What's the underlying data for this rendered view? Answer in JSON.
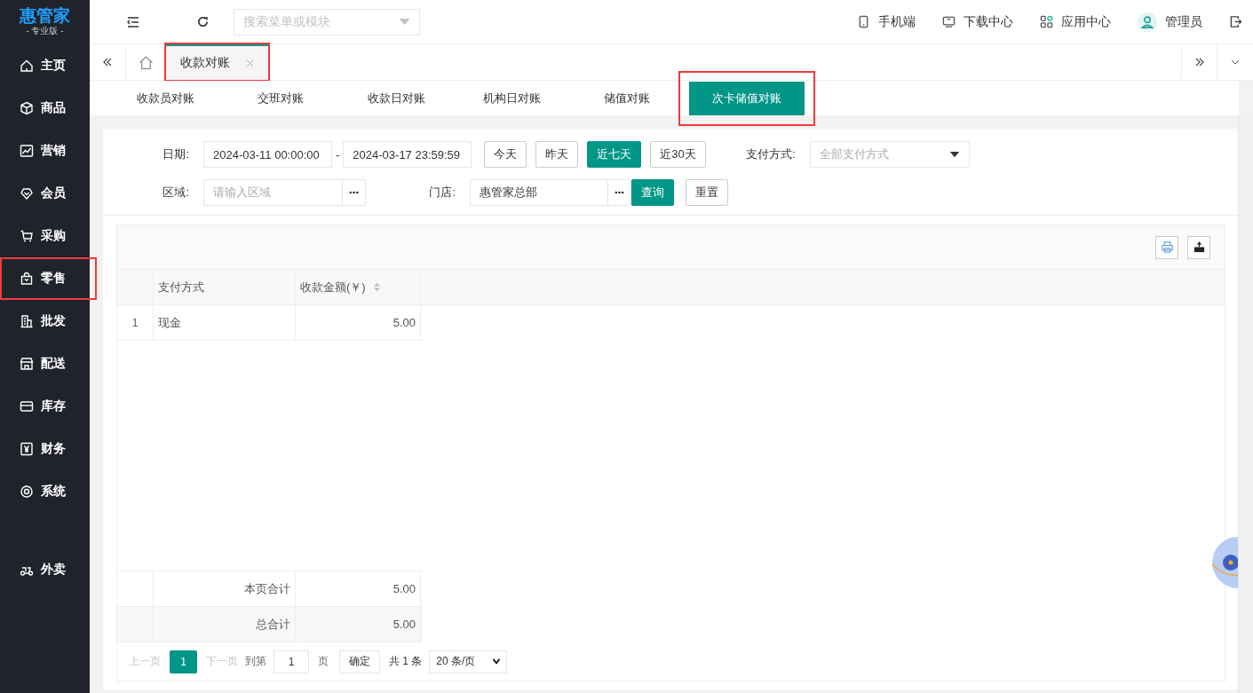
{
  "app": {
    "logo": "惠管家",
    "edition": "- 专业版 -"
  },
  "sidebar": {
    "items": [
      {
        "label": "主页",
        "highlighted": false
      },
      {
        "label": "商品",
        "highlighted": false
      },
      {
        "label": "营销",
        "highlighted": false
      },
      {
        "label": "会员",
        "highlighted": false
      },
      {
        "label": "采购",
        "highlighted": false
      },
      {
        "label": "零售",
        "highlighted": true
      },
      {
        "label": "批发",
        "highlighted": false
      },
      {
        "label": "配送",
        "highlighted": false
      },
      {
        "label": "库存",
        "highlighted": false
      },
      {
        "label": "财务",
        "highlighted": false
      },
      {
        "label": "系统",
        "highlighted": false
      }
    ],
    "bottom_items": [
      {
        "label": "外卖",
        "highlighted": false
      }
    ]
  },
  "topbar": {
    "search": {
      "placeholder": "搜索菜单或模块"
    },
    "actions": [
      {
        "label": "手机端"
      },
      {
        "label": "下载中心"
      },
      {
        "label": "应用中心"
      },
      {
        "label": "管理员"
      }
    ]
  },
  "tabs": [
    {
      "label": "收款对账",
      "selected": true,
      "highlighted": true
    }
  ],
  "subtabs": [
    {
      "label": "收款员对账",
      "selected": false,
      "highlighted": false
    },
    {
      "label": "交班对账",
      "selected": false,
      "highlighted": false
    },
    {
      "label": "收款日对账",
      "selected": false,
      "highlighted": false
    },
    {
      "label": "机构日对账",
      "selected": false,
      "highlighted": false
    },
    {
      "label": "储值对账",
      "selected": false,
      "highlighted": false
    },
    {
      "label": "次卡储值对账",
      "selected": true,
      "highlighted": true
    }
  ],
  "filters": {
    "date_label": "日期:",
    "date_start": "2024-03-11 00:00:00",
    "date_separator": "-",
    "date_end": "2024-03-17 23:59:59",
    "quick_ranges": [
      {
        "label": "今天",
        "selected": false
      },
      {
        "label": "昨天",
        "selected": false
      },
      {
        "label": "近七天",
        "selected": true
      },
      {
        "label": "近30天",
        "selected": false
      }
    ],
    "payment_label": "支付方式:",
    "payment_placeholder": "全部支付方式",
    "region_label": "区域:",
    "region_placeholder": "请输入区域",
    "store_label": "门店:",
    "store_value": "惠管家总部",
    "search_button": "查询",
    "reset_button": "重置"
  },
  "table": {
    "columns": [
      "支付方式",
      "收款金额(￥)"
    ],
    "rows": [
      {
        "index": "1",
        "method": "现金",
        "amount": "5.00"
      }
    ],
    "totals": [
      {
        "label": "本页合计",
        "amount": "5.00"
      },
      {
        "label": "总合计",
        "amount": "5.00"
      }
    ]
  },
  "pagination": {
    "prev": {
      "label": "上一页",
      "disabled": true
    },
    "pages": [
      {
        "label": "1",
        "selected": true
      }
    ],
    "next": {
      "label": "下一页",
      "disabled": true
    },
    "goto_label": "到第",
    "page_input": "1",
    "page_unit": "页",
    "confirm": "确定",
    "total": "共 1 条",
    "page_size": "20 条/页"
  }
}
